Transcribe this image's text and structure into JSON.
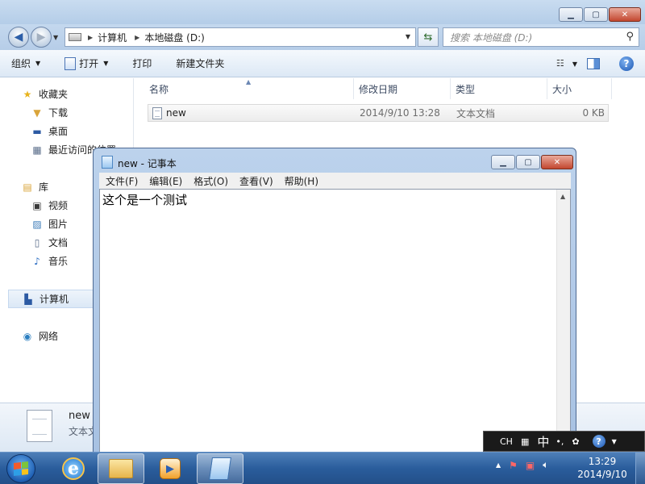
{
  "explorer": {
    "address": [
      "计算机",
      "本地磁盘 (D:)"
    ],
    "search_placeholder": "搜索 本地磁盘 (D:)",
    "toolbar": {
      "organize": "组织",
      "open": "打开",
      "print": "打印",
      "new_folder": "新建文件夹"
    },
    "nav": {
      "favorites": {
        "label": "收藏夹",
        "items": [
          "下载",
          "桌面",
          "最近访问的位置"
        ]
      },
      "libraries": {
        "label": "库",
        "items": [
          "视频",
          "图片",
          "文档",
          "音乐"
        ]
      },
      "computer": "计算机",
      "network": "网络"
    },
    "columns": {
      "name": "名称",
      "date": "修改日期",
      "type": "类型",
      "size": "大小"
    },
    "files": [
      {
        "name": "new",
        "date": "2014/9/10 13:28",
        "type": "文本文档",
        "size": "0 KB"
      }
    ],
    "details": {
      "name": "new",
      "type": "文本文档"
    }
  },
  "notepad": {
    "title": "new - 记事本",
    "menu": [
      "文件(F)",
      "编辑(E)",
      "格式(O)",
      "查看(V)",
      "帮助(H)"
    ],
    "content": "这个是一个测试"
  },
  "language_bar": {
    "lang": "CH",
    "ime": "中"
  },
  "taskbar": {
    "time": "13:29",
    "date": "2014/9/10"
  },
  "icons": {
    "favorites": "star-icon",
    "downloads": "download-folder-icon",
    "desktop": "desktop-icon",
    "recent": "recent-places-icon",
    "library": "library-icon",
    "video": "video-icon",
    "pictures": "pictures-icon",
    "documents": "documents-icon",
    "music": "music-icon",
    "computer": "computer-icon",
    "network": "network-icon"
  },
  "colors": {
    "accent": "#1d5fa8",
    "close": "#c3472f"
  }
}
